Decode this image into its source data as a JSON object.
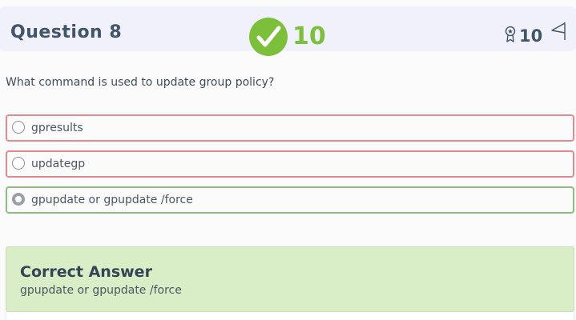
{
  "header": {
    "title": "Question 8",
    "result_icon": "checkmark-circle-icon",
    "score": "10",
    "points_icon": "award-ribbon-icon",
    "points": "10",
    "flag_icon": "flag-icon"
  },
  "question": {
    "text": "What command is used to update group policy?"
  },
  "options": [
    {
      "label": "gpresults",
      "state": "incorrect",
      "selected": false
    },
    {
      "label": "updategp",
      "state": "incorrect",
      "selected": false
    },
    {
      "label": "gpupdate or gpupdate /force",
      "state": "correct",
      "selected": true
    }
  ],
  "answer": {
    "heading": "Correct Answer",
    "text": "gpupdate or gpupdate /force"
  },
  "colors": {
    "correct": "#7cbf3a",
    "incorrect_border": "#e28a90",
    "correct_border": "#8ac07a",
    "answer_bg": "#d9eec6",
    "header_bg": "#f0f1fa"
  }
}
